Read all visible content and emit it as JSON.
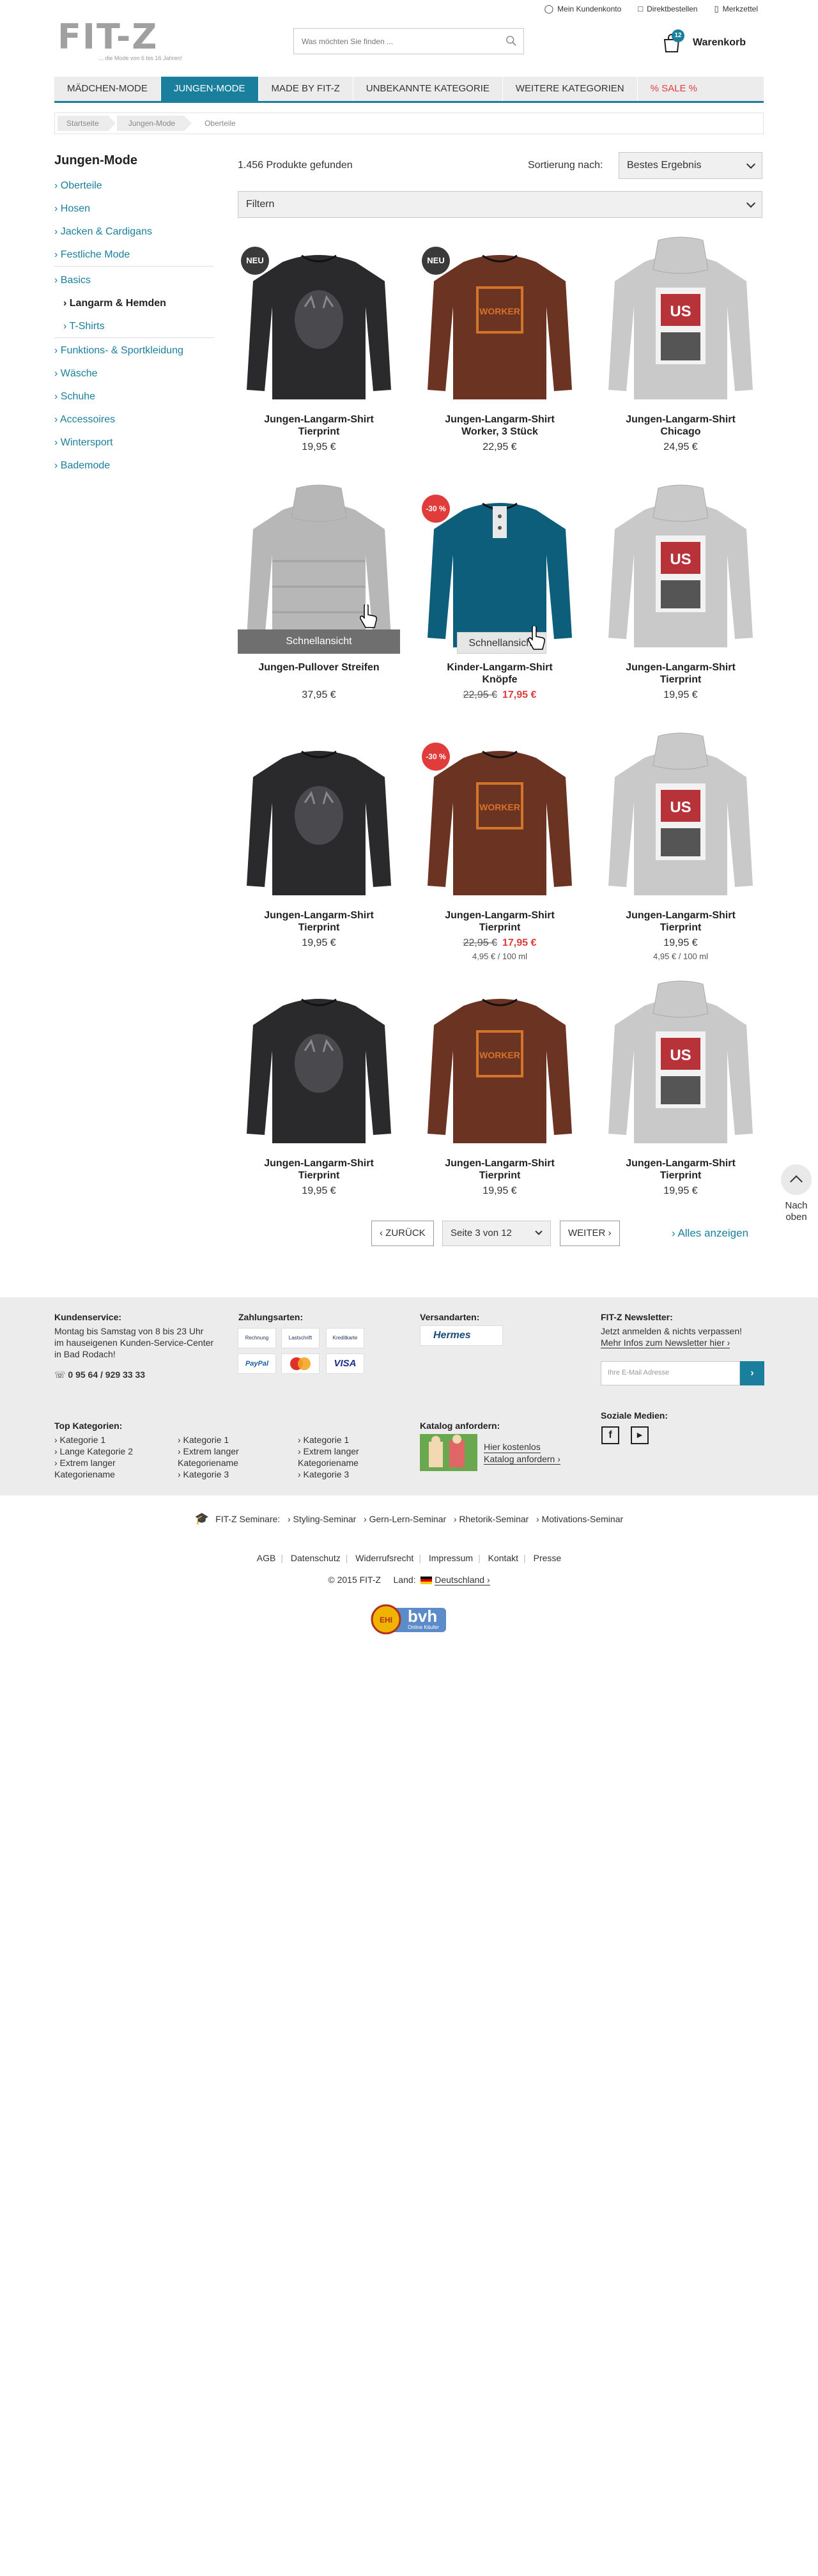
{
  "header": {
    "logo_text": "FIT-Z",
    "logo_tagline": "... die Mode von 6 bis 16 Jahren!",
    "top_links": [
      "Mein Kundenkonto",
      "Direktbestellen",
      "Merkzettel"
    ],
    "search_placeholder": "Was möchten Sie finden ...",
    "cart_count": "12",
    "cart_label": "Warenkorb"
  },
  "nav": {
    "items": [
      "Mädchen-Mode",
      "Jungen-Mode",
      "Made by FIT-Z",
      "Unbekannte Kategorie",
      "Weitere Kategorien",
      "% Sale %"
    ],
    "active": "Jungen-Mode"
  },
  "breadcrumb": [
    "Startseite",
    "Jungen-Mode",
    "Oberteile"
  ],
  "sidebar": {
    "title": "Jungen-Mode",
    "items": [
      "› Oberteile",
      "› Hosen",
      "› Jacken & Cardigans",
      "› Festliche Mode",
      "› Basics",
      "› Langarm & Hemden",
      "› T-Shirts",
      "› Funktions- & Sportkleidung",
      "› Wäsche",
      "› Schuhe",
      "› Accessoires",
      "› Wintersport",
      "› Bademode"
    ]
  },
  "toolbar": {
    "count": "1.456 Produkte gefunden",
    "sort_label": "Sortierung nach:",
    "sort_value": "Bestes Ergebnis",
    "filter_label": "Filtern"
  },
  "products": [
    {
      "name": "Jungen-Langarm-Shirt Tierprint",
      "price": "19,95 €",
      "badge": "NEU",
      "color": "black"
    },
    {
      "name": "Jungen-Langarm-Shirt Worker, 3 Stück",
      "price": "22,95 €",
      "badge": "NEU",
      "color": "brown"
    },
    {
      "name": "Jungen-Langarm-Shirt Chicago",
      "price": "24,95 €",
      "badge": "",
      "color": "grey"
    },
    {
      "name": "Jungen-Pullover Streifen",
      "price": "37,95 €",
      "badge": "",
      "color": "lightgrey",
      "overlay": "Schnellansicht"
    },
    {
      "name": "Kinder-Langarm-Shirt Knöpfe",
      "old_price": "22,95 €",
      "price": "17,95 €",
      "badge": "-30 %",
      "color": "teal",
      "overlay": "Schnellansicht"
    },
    {
      "name": "Jungen-Langarm-Shirt Tierprint",
      "price": "19,95 €",
      "badge": "",
      "color": "grey"
    },
    {
      "name": "Jungen-Langarm-Shirt Tierprint",
      "price": "19,95 €",
      "badge": "",
      "color": "black"
    },
    {
      "name": "Jungen-Langarm-Shirt Tierprint",
      "old_price": "22,95 €",
      "price": "17,95 €",
      "unit": "4,95 € / 100 ml",
      "badge": "-30 %",
      "color": "brown"
    },
    {
      "name": "Jungen-Langarm-Shirt Tierprint",
      "price": "19,95 €",
      "unit": "4,95 € / 100 ml",
      "badge": "",
      "color": "grey"
    },
    {
      "name": "Jungen-Langarm-Shirt Tierprint",
      "price": "19,95 €",
      "badge": "",
      "color": "black"
    },
    {
      "name": "Jungen-Langarm-Shirt Tierprint",
      "price": "19,95 €",
      "badge": "",
      "color": "brown"
    },
    {
      "name": "Jungen-Langarm-Shirt Tierprint",
      "price": "19,95 €",
      "badge": "",
      "color": "grey"
    }
  ],
  "pagination": {
    "back": "‹ ZURÜCK",
    "page": "Seite 3 von 12",
    "next": "WEITER ›",
    "show_all": "› Alles anzeigen"
  },
  "back_to_top": "Nach oben",
  "footer": {
    "service_title": "Kundenservice:",
    "service_text": "Montag bis Samstag von 8 bis 23 Uhr im hauseigenen Kunden-Service-Center in Bad Rodach!",
    "phone": "0 95 64 / 929 33 33",
    "payment_title": "Zahlungsarten:",
    "payment_methods": [
      "Rechnung",
      "Lastschrift",
      "Kreditkarte",
      "PayPal",
      "MasterCard",
      "VISA"
    ],
    "shipping_title": "Versandarten:",
    "shipping_method": "Hermes",
    "newsletter_title": "FIT-Z Newsletter:",
    "newsletter_text": "Jetzt anmelden & nichts verpassen!",
    "newsletter_link": "Mehr Infos zum Newsletter hier ›",
    "newsletter_placeholder": "Ihre E-Mail Adresse",
    "newsletter_button": "›",
    "top_cat_title": "Top Kategorien:",
    "top_cat_col1": [
      "› Kategorie 1",
      "› Lange Kategorie 2",
      "› Extrem langer Kategoriename"
    ],
    "top_cat_col2": [
      "› Kategorie 1",
      "› Extrem langer Kategoriename",
      "› Kategorie 3"
    ],
    "top_cat_col3": [
      "› Kategorie 1",
      "› Extrem langer Kategoriename",
      "› Kategorie 3"
    ],
    "catalog_title": "Katalog anfordern:",
    "catalog_text": "Hier kostenlos",
    "catalog_link": "Katalog anfordern ›",
    "social_title": "Soziale Medien:",
    "seminare_label": "FIT-Z Seminare:",
    "seminare": [
      "› Styling-Seminar",
      "› Gern-Lern-Seminar",
      "› Rhetorik-Seminar",
      "› Motivations-Seminar"
    ],
    "links": [
      "AGB",
      "Datenschutz",
      "Widerrufsrecht",
      "Impressum",
      "Kontakt",
      "Presse"
    ],
    "copyright": "© 2015 FIT-Z",
    "country_label": "Land:",
    "country": "Deutschland ›",
    "bvh_label": "bvh",
    "bvh_sub": "Online Käufer"
  },
  "colors": {
    "accent": "#1a7f9c",
    "sale": "#e03c3c"
  }
}
